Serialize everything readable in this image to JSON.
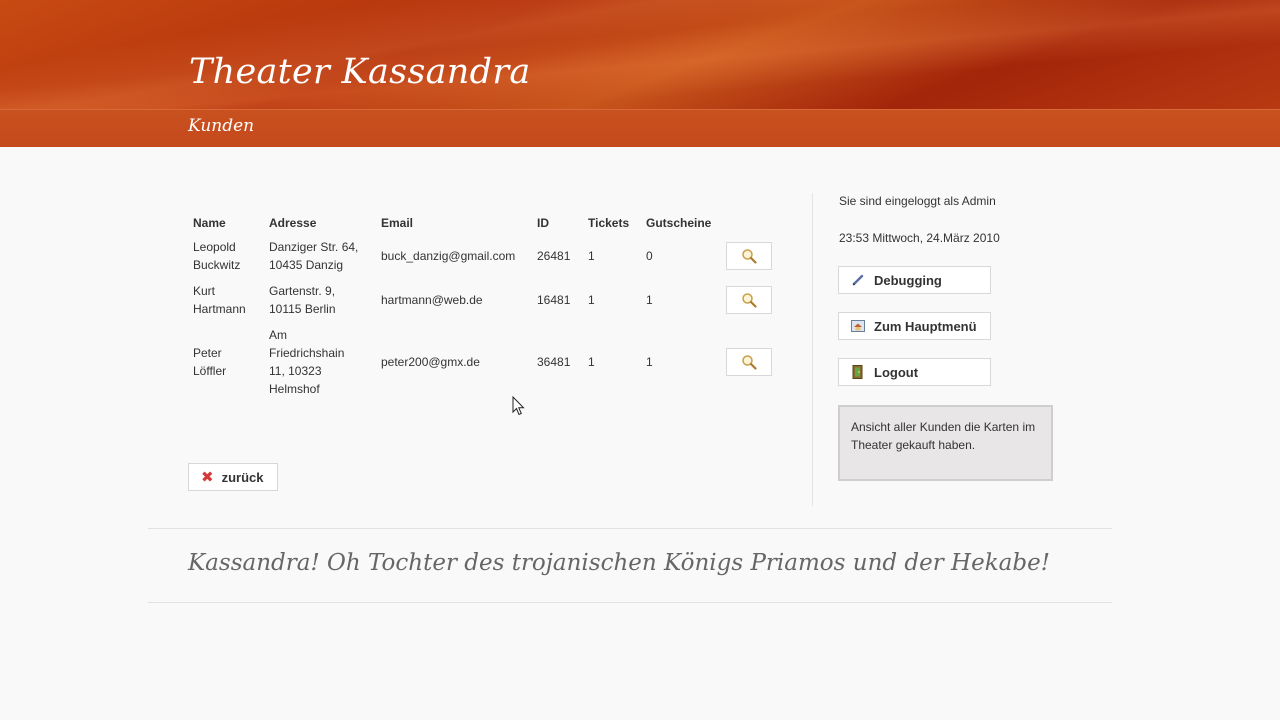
{
  "header": {
    "site_title": "Theater Kassandra",
    "subtitle": "Kunden"
  },
  "table": {
    "columns": [
      "Name",
      "Adresse",
      "Email",
      "ID",
      "Tickets",
      "Gutscheine"
    ],
    "rows": [
      {
        "name": [
          "Leopold",
          "Buckwitz"
        ],
        "address": [
          "Danziger Str. 64,",
          "10435 Danzig"
        ],
        "email": "buck_danzig@gmail.com",
        "id": "26481",
        "tickets": "1",
        "gutscheine": "0"
      },
      {
        "name": [
          "Kurt",
          "Hartmann"
        ],
        "address": [
          "Gartenstr. 9,",
          "10115 Berlin"
        ],
        "email": "hartmann@web.de",
        "id": "16481",
        "tickets": "1",
        "gutscheine": "1"
      },
      {
        "name": [
          "Peter",
          "Löffler"
        ],
        "address": [
          "Am",
          "Friedrichshain",
          "11, 10323",
          "Helmshof"
        ],
        "email": "peter200@gmx.de",
        "id": "36481",
        "tickets": "1",
        "gutscheine": "1"
      }
    ]
  },
  "back_button": {
    "label": "zurück",
    "icon": "red-x-icon"
  },
  "sidebar": {
    "logged_in_text": "Sie sind eingeloggt als Admin",
    "datetime": "23:53 Mittwoch, 24.März 2010",
    "buttons": {
      "debugging": {
        "label": "Debugging",
        "icon": "pencil-icon"
      },
      "hauptmenu": {
        "label": "Zum Hauptmenü",
        "icon": "home-menu-icon"
      },
      "logout": {
        "label": "Logout",
        "icon": "logout-door-icon"
      }
    },
    "info_box": "Ansicht aller Kunden die Karten im Theater gekauft haben."
  },
  "footer": {
    "quote": "Kassandra! Oh Tochter des trojanischen Königs Priamos und der Hekabe!"
  },
  "colors": {
    "header_red": "#b3300c",
    "subnav_orange": "#c44a1c",
    "page_bg": "#f9f9f9",
    "info_box_bg": "#e8e6e6"
  }
}
